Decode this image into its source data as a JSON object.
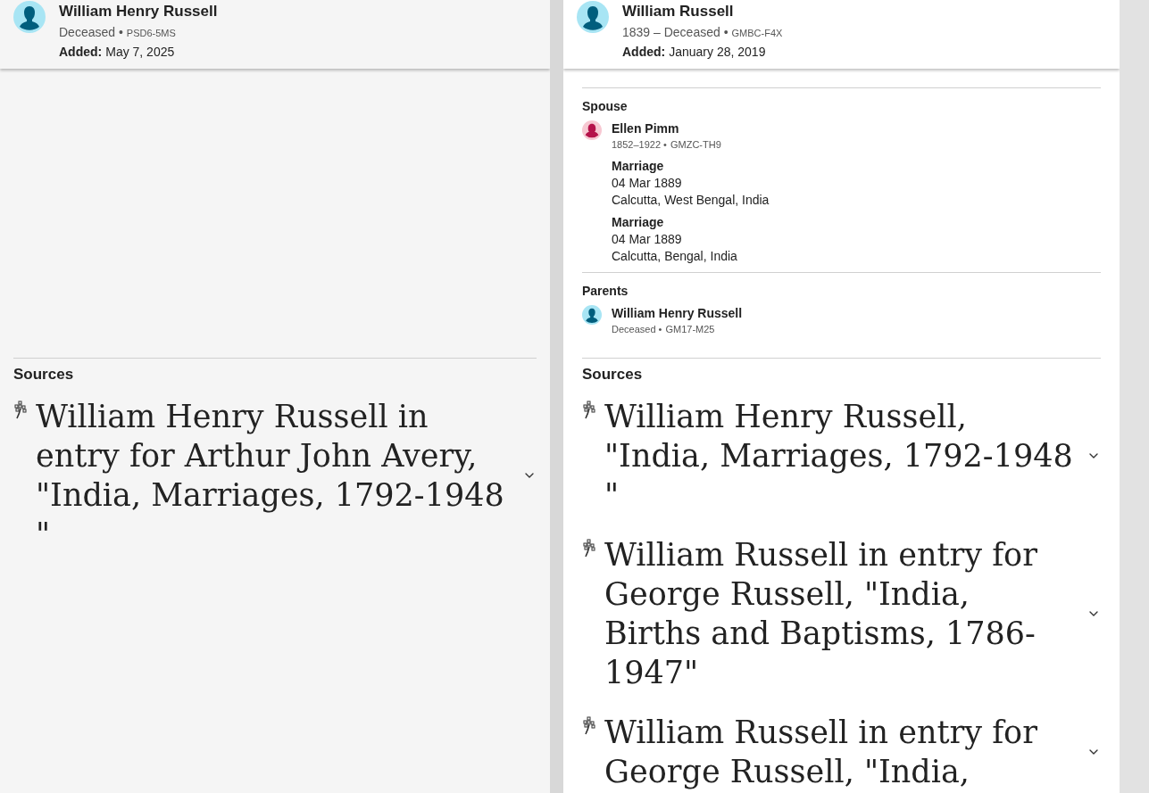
{
  "panels": [
    {
      "header": {
        "name": "William Henry Russell",
        "vitals": "Deceased •",
        "id": "PSD6-5MS",
        "added_label": "Added:",
        "added_date": "May 7, 2025",
        "kind": "male"
      },
      "sources": {
        "title": "Sources",
        "items": [
          {
            "title": "William Henry Russell in entry for Arthur John Avery, \"India, Marriages, 1792-1948 \""
          }
        ]
      }
    },
    {
      "header": {
        "name": "William Russell",
        "vitals": "1839 – Deceased •",
        "id": "GMBC-F4X",
        "added_label": "Added:",
        "added_date": "January 28, 2019",
        "kind": "male"
      },
      "sections": [
        {
          "title": "Spouse",
          "people": [
            {
              "name": "Ellen Pimm",
              "vitals": "1852–1922 •",
              "id": "GMZC-TH9",
              "kind": "female",
              "events": [
                {
                  "type": "Marriage",
                  "date": "04 Mar 1889",
                  "place": "Calcutta, West Bengal, India"
                },
                {
                  "type": "Marriage",
                  "date": "04 Mar 1889",
                  "place": "Calcutta, Bengal, India"
                }
              ]
            }
          ]
        },
        {
          "title": "Parents",
          "people": [
            {
              "name": "William Henry Russell",
              "vitals": "Deceased •",
              "id": "GM17-M25",
              "kind": "male"
            }
          ]
        }
      ],
      "sources": {
        "title": "Sources",
        "items": [
          {
            "title": "William Henry Russell, \"India, Marriages, 1792-1948 \""
          },
          {
            "title": "William Russell in entry for George Russell, \"India, Births and Baptisms, 1786-1947\""
          },
          {
            "title": "William Russell in entry for George Russell, \"India,"
          }
        ]
      }
    }
  ]
}
